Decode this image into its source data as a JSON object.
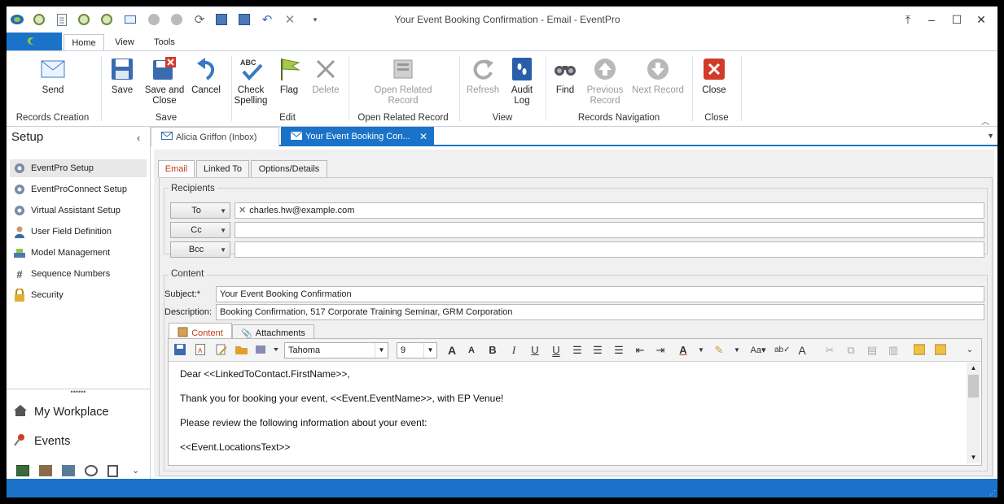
{
  "window": {
    "title": "Your Event Booking Confirmation  - Email - EventPro"
  },
  "quick_access": [
    "logo-icon",
    "clock-icon",
    "document-icon",
    "clock-icon",
    "clock-icon",
    "mail-icon",
    "up-arrow-icon",
    "down-arrow-icon",
    "refresh-icon",
    "save-icon",
    "save-close-icon",
    "undo-icon",
    "close-icon",
    "qat-dropdown-icon"
  ],
  "ribbon_tabs": {
    "home": "Home",
    "view": "View",
    "tools": "Tools"
  },
  "ribbon": {
    "send": "Send",
    "save": "Save",
    "save_close_1": "Save and",
    "save_close_2": "Close",
    "cancel": "Cancel",
    "check_1": "Check",
    "check_2": "Spelling",
    "flag": "Flag",
    "delete": "Delete",
    "open_related_1": "Open Related",
    "open_related_2": "Record",
    "refresh": "Refresh",
    "audit_1": "Audit",
    "audit_2": "Log",
    "find": "Find",
    "prev_1": "Previous",
    "prev_2": "Record",
    "next_1": "Next Record",
    "close": "Close",
    "groups": {
      "records_creation": "Records Creation",
      "save": "Save",
      "edit": "Edit",
      "open_related": "Open Related Record",
      "view": "View",
      "navigation": "Records Navigation",
      "close": "Close"
    },
    "abc": "ABC"
  },
  "sidebar": {
    "title": "Setup",
    "items": [
      {
        "label": "EventPro Setup"
      },
      {
        "label": "EventProConnect Setup"
      },
      {
        "label": "Virtual Assistant Setup"
      },
      {
        "label": "User Field Definition"
      },
      {
        "label": "Model Management"
      },
      {
        "label": "Sequence Numbers"
      },
      {
        "label": "Security"
      }
    ],
    "workplace": "My Workplace",
    "events": "Events"
  },
  "doc_tabs": {
    "inbox": "Alicia Griffon (Inbox)",
    "current": "Your Event Booking Con..."
  },
  "form_tabs": {
    "email": "Email",
    "linked": "Linked To",
    "options": "Options/Details"
  },
  "recipients": {
    "legend": "Recipients",
    "to_label": "To",
    "cc_label": "Cc",
    "bcc_label": "Bcc",
    "to_value": "charles.hw@example.com"
  },
  "content": {
    "legend": "Content",
    "subject_label": "Subject:*",
    "subject": "Your Event Booking Confirmation",
    "description_label": "Description:",
    "description": "Booking Confirmation, 517 Corporate Training Seminar, GRM Corporation",
    "tab_content": "Content",
    "tab_attachments": "Attachments",
    "font": "Tahoma",
    "size": "9"
  },
  "body": [
    "Dear <<LinkedToContact.FirstName>>,",
    "Thank you for booking your event, <<Event.EventName>>, with EP Venue!",
    "Please review the following information about your event:",
    "<<Event.LocationsText>>"
  ],
  "colors": {
    "accent": "#1a73c8",
    "red": "#d23a2a"
  }
}
